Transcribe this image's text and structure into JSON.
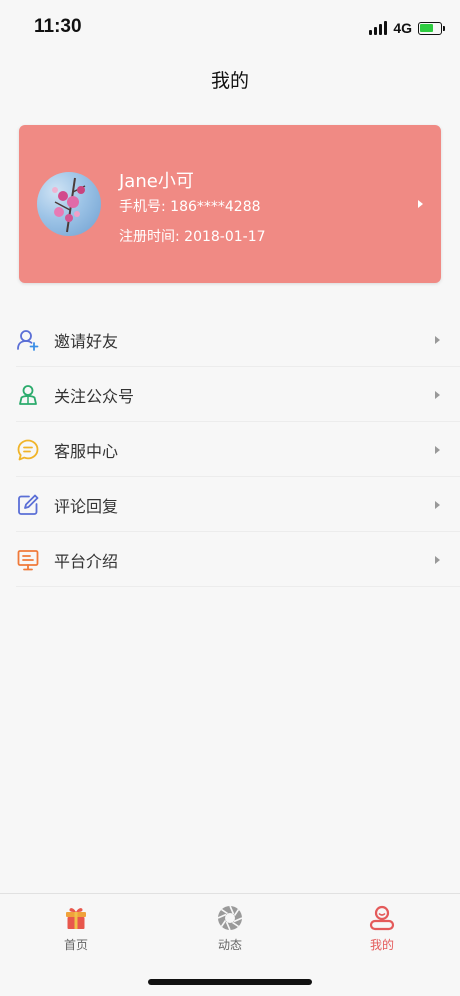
{
  "status_bar": {
    "time": "11:30",
    "network": "4G"
  },
  "page_title": "我的",
  "profile": {
    "name": "Jane小可",
    "phone": "手机号: 186****4288",
    "register": "注册时间: 2018-01-17"
  },
  "menu": [
    {
      "label": "邀请好友",
      "icon": "invite-friend-icon",
      "color": "#5b6fd6"
    },
    {
      "label": "关注公众号",
      "icon": "follow-account-icon",
      "color": "#2bab6c"
    },
    {
      "label": "客服中心",
      "icon": "customer-service-icon",
      "color": "#f0b429"
    },
    {
      "label": "评论回复",
      "icon": "comment-reply-icon",
      "color": "#5b6fd6"
    },
    {
      "label": "平台介绍",
      "icon": "platform-intro-icon",
      "color": "#f07a3a"
    }
  ],
  "tabs": [
    {
      "label": "首页",
      "icon": "gift-icon"
    },
    {
      "label": "动态",
      "icon": "aperture-icon"
    },
    {
      "label": "我的",
      "icon": "profile-icon",
      "active": true
    }
  ],
  "colors": {
    "card": "#f08a84",
    "accent": "#e45a5a"
  }
}
